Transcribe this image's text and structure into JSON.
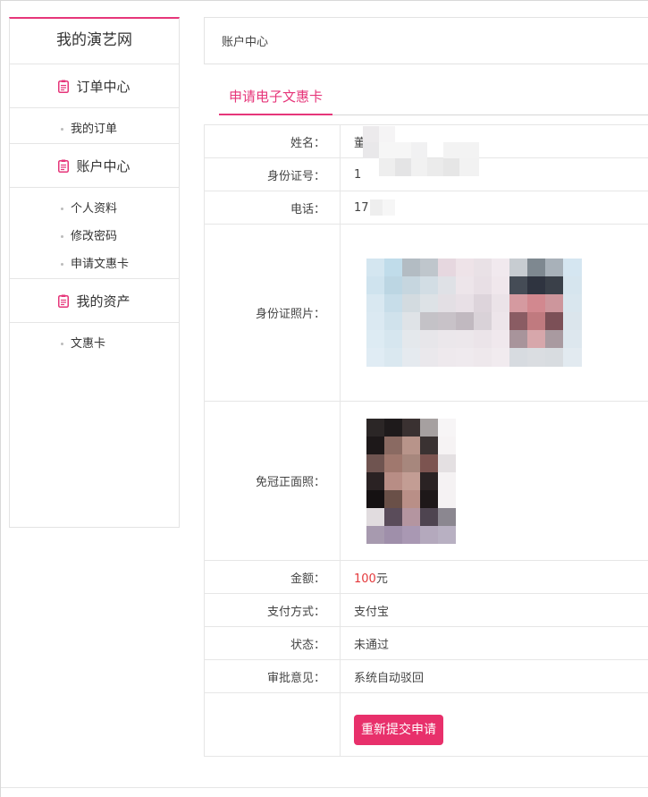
{
  "sidebar": {
    "site_title": "我的演艺网",
    "groups": [
      {
        "title": "订单中心",
        "items": [
          "我的订单"
        ]
      },
      {
        "title": "账户中心",
        "items": [
          "个人资料",
          "修改密码",
          "申请文惠卡"
        ]
      },
      {
        "title": "我的资产",
        "items": [
          "文惠卡"
        ]
      }
    ]
  },
  "breadcrumb": "账户中心",
  "tab": {
    "active": "申请电子文惠卡"
  },
  "form": {
    "name": {
      "label": "姓名：",
      "value": "董"
    },
    "id_number": {
      "label": "身份证号：",
      "value": "1"
    },
    "phone": {
      "label": "电话：",
      "value": "17"
    },
    "id_photo": {
      "label": "身份证照片："
    },
    "face_photo": {
      "label": "免冠正面照："
    },
    "amount": {
      "label": "金额：",
      "value": "100",
      "unit": "元"
    },
    "payment": {
      "label": "支付方式：",
      "value": "支付宝"
    },
    "status": {
      "label": "状态：",
      "value": "未通过"
    },
    "opinion": {
      "label": "审批意见：",
      "value": "系统自动驳回"
    },
    "resubmit_label": "重新提交申请"
  },
  "colors": {
    "accent": "#e6367a",
    "button": "#e8306b",
    "amount": "#e4393c"
  },
  "icons": {
    "group_icon": "clipboard-icon"
  }
}
